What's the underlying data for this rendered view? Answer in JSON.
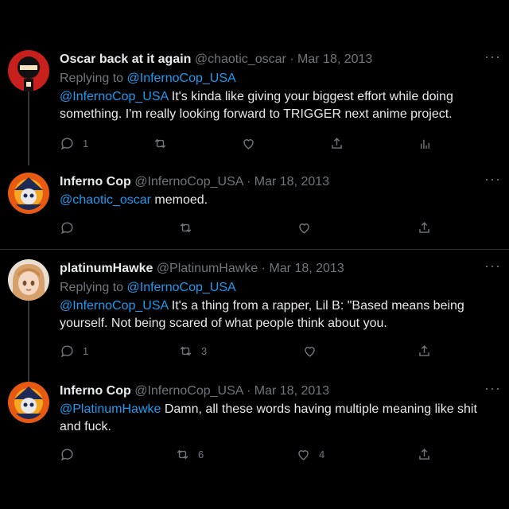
{
  "tweets": [
    {
      "display_name": "Oscar back at it again",
      "handle": "@chaotic_oscar",
      "date": "Mar 18, 2013",
      "replying_prefix": "Replying to ",
      "replying_to": "@InfernoCop_USA",
      "mention": "@InfernoCop_USA",
      "text": " It's kinda like giving your biggest effort while doing something. I'm really looking forward to TRIGGER next anime project.",
      "reply_count": "1",
      "retweet_count": "",
      "like_count": "",
      "has_analytics": true,
      "avatar_colors": [
        "#c8201c",
        "#111111",
        "#f3e3c0"
      ]
    },
    {
      "display_name": "Inferno Cop",
      "handle": "@InfernoCop_USA",
      "date": "Mar 18, 2013",
      "mention": "@chaotic_oscar",
      "text": " memoed.",
      "reply_count": "",
      "retweet_count": "",
      "like_count": "",
      "has_analytics": false,
      "avatar_colors": [
        "#e85a12",
        "#1d2a55",
        "#e9e9e9"
      ]
    },
    {
      "display_name": "platinumHawke",
      "handle": "@PlatinumHawke",
      "date": "Mar 18, 2013",
      "replying_prefix": "Replying to ",
      "replying_to": "@InfernoCop_USA",
      "mention": "@InfernoCop_USA",
      "text": " It's a thing from a rapper, Lil B: \"Based means being yourself. Not being scared of what people think about you.",
      "reply_count": "1",
      "retweet_count": "3",
      "like_count": "",
      "has_analytics": false,
      "avatar_colors": [
        "#d8a06a",
        "#f4d8c4",
        "#7b4d2b"
      ]
    },
    {
      "display_name": "Inferno Cop",
      "handle": "@InfernoCop_USA",
      "date": "Mar 18, 2013",
      "mention": "@PlatinumHawke",
      "text": " Damn, all these words having multiple meaning like shit and fuck.",
      "reply_count": "",
      "retweet_count": "6",
      "like_count": "4",
      "has_analytics": false,
      "avatar_colors": [
        "#e85a12",
        "#1d2a55",
        "#e9e9e9"
      ]
    }
  ],
  "separator": " · ",
  "more_glyph": "···",
  "icons": [
    "reply-icon",
    "retweet-icon",
    "like-icon",
    "share-icon",
    "analytics-icon",
    "more-icon"
  ],
  "colors": {
    "background": "#000000",
    "text": "#e7e9ea",
    "muted": "#71767b",
    "link": "#1d9bf0",
    "line": "#333639"
  }
}
